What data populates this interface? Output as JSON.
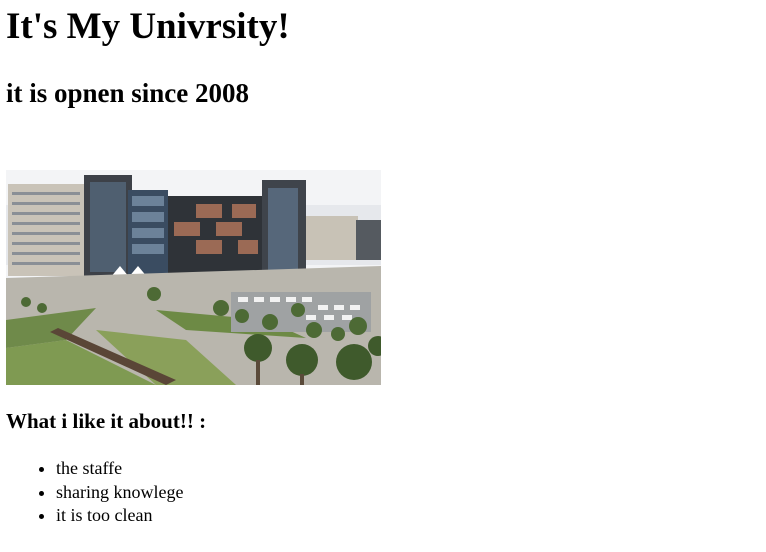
{
  "page": {
    "title": "It's My Univrsity!",
    "subtitle": "it is opnen since 2008",
    "image": {
      "subject": "campus-building-photo"
    },
    "likes_heading": "What i like it about!! :",
    "likes": [
      "the staffe",
      "sharing knowlege",
      "it is too clean"
    ]
  }
}
